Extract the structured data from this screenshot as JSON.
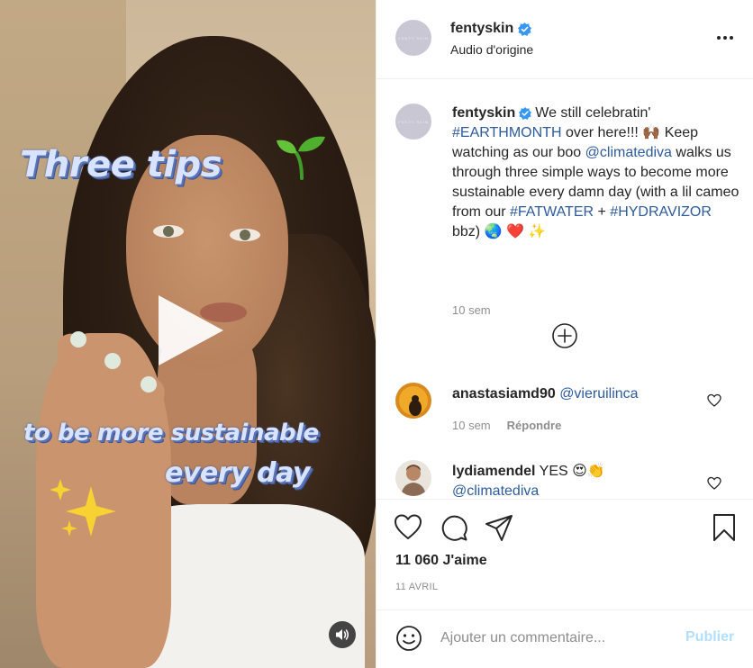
{
  "video": {
    "overlay_line1": "Three tips",
    "overlay_line2": "to be more sustainable",
    "overlay_line3": "every day"
  },
  "post": {
    "avatar_text": "FENTY SKIN",
    "username": "fentyskin",
    "audio": "Audio d'origine",
    "caption": {
      "username": "fentyskin",
      "text_1": "We still celebratin' ",
      "tag_1": "#EARTHMONTH",
      "text_2": " over here!!! 🙌🏾 Keep watching as our boo ",
      "mention_1": "@climatediva",
      "text_3": " walks us through three simple ways to become more sustainable every damn day (with a lil cameo from our ",
      "tag_2": "#FATWATER",
      "text_4": " + ",
      "tag_3": "#HYDRAVIZOR",
      "text_5": " bbz) 🌏 ❤️ ✨",
      "time": "10 sem"
    },
    "comments": [
      {
        "username": "anastasiamd90",
        "text": "",
        "mention": "@vieruilinca",
        "time": "10 sem",
        "reply": "Répondre"
      },
      {
        "username": "lydiamendel",
        "text": "YES 😍👏",
        "mention": "@climatediva",
        "time": "",
        "reply": ""
      }
    ],
    "likes": "11 060 J'aime",
    "date": "11 AVRIL",
    "add_comment_placeholder": "Ajouter un commentaire...",
    "publish_label": "Publier"
  },
  "colors": {
    "link": "#2d5b9b",
    "verified": "#3897f0",
    "publish_disabled": "#b2dffc",
    "muted": "#8e8e8e"
  }
}
